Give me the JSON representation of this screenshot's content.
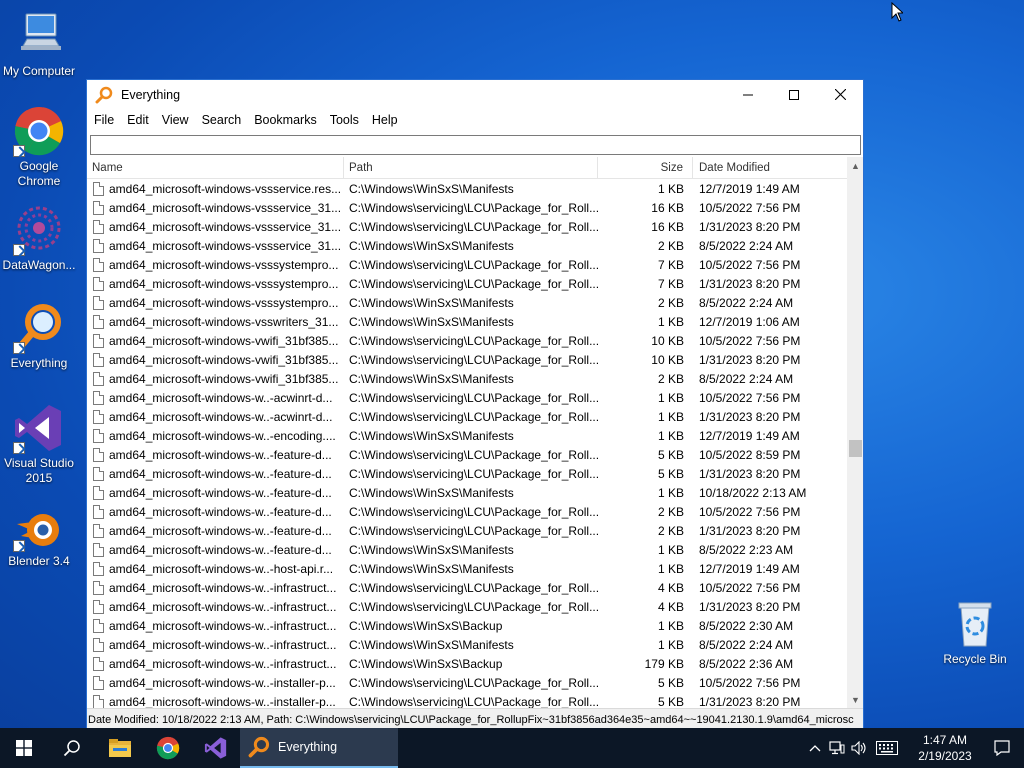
{
  "desktop": {
    "icons": [
      {
        "label": "My Computer"
      },
      {
        "label": "Google Chrome"
      },
      {
        "label": "DataWagon..."
      },
      {
        "label": "Everything"
      },
      {
        "label": "Visual Studio 2015"
      },
      {
        "label": "Blender 3.4"
      },
      {
        "label": "Recycle Bin"
      }
    ]
  },
  "window": {
    "title": "Everything",
    "menu": [
      "File",
      "Edit",
      "View",
      "Search",
      "Bookmarks",
      "Tools",
      "Help"
    ],
    "search": {
      "value": "",
      "placeholder": ""
    },
    "columns": {
      "name": "Name",
      "path": "Path",
      "size": "Size",
      "date": "Date Modified"
    },
    "rows": [
      {
        "name": "amd64_microsoft-windows-vssservice.res...",
        "path": "C:\\Windows\\WinSxS\\Manifests",
        "size": "1 KB",
        "date": "12/7/2019 1:49 AM"
      },
      {
        "name": "amd64_microsoft-windows-vssservice_31...",
        "path": "C:\\Windows\\servicing\\LCU\\Package_for_Roll...",
        "size": "16 KB",
        "date": "10/5/2022 7:56 PM"
      },
      {
        "name": "amd64_microsoft-windows-vssservice_31...",
        "path": "C:\\Windows\\servicing\\LCU\\Package_for_Roll...",
        "size": "16 KB",
        "date": "1/31/2023 8:20 PM"
      },
      {
        "name": "amd64_microsoft-windows-vssservice_31...",
        "path": "C:\\Windows\\WinSxS\\Manifests",
        "size": "2 KB",
        "date": "8/5/2022 2:24 AM"
      },
      {
        "name": "amd64_microsoft-windows-vsssystempro...",
        "path": "C:\\Windows\\servicing\\LCU\\Package_for_Roll...",
        "size": "7 KB",
        "date": "10/5/2022 7:56 PM"
      },
      {
        "name": "amd64_microsoft-windows-vsssystempro...",
        "path": "C:\\Windows\\servicing\\LCU\\Package_for_Roll...",
        "size": "7 KB",
        "date": "1/31/2023 8:20 PM"
      },
      {
        "name": "amd64_microsoft-windows-vsssystempro...",
        "path": "C:\\Windows\\WinSxS\\Manifests",
        "size": "2 KB",
        "date": "8/5/2022 2:24 AM"
      },
      {
        "name": "amd64_microsoft-windows-vsswriters_31...",
        "path": "C:\\Windows\\WinSxS\\Manifests",
        "size": "1 KB",
        "date": "12/7/2019 1:06 AM"
      },
      {
        "name": "amd64_microsoft-windows-vwifi_31bf385...",
        "path": "C:\\Windows\\servicing\\LCU\\Package_for_Roll...",
        "size": "10 KB",
        "date": "10/5/2022 7:56 PM"
      },
      {
        "name": "amd64_microsoft-windows-vwifi_31bf385...",
        "path": "C:\\Windows\\servicing\\LCU\\Package_for_Roll...",
        "size": "10 KB",
        "date": "1/31/2023 8:20 PM"
      },
      {
        "name": "amd64_microsoft-windows-vwifi_31bf385...",
        "path": "C:\\Windows\\WinSxS\\Manifests",
        "size": "2 KB",
        "date": "8/5/2022 2:24 AM"
      },
      {
        "name": "amd64_microsoft-windows-w..-acwinrt-d...",
        "path": "C:\\Windows\\servicing\\LCU\\Package_for_Roll...",
        "size": "1 KB",
        "date": "10/5/2022 7:56 PM"
      },
      {
        "name": "amd64_microsoft-windows-w..-acwinrt-d...",
        "path": "C:\\Windows\\servicing\\LCU\\Package_for_Roll...",
        "size": "1 KB",
        "date": "1/31/2023 8:20 PM"
      },
      {
        "name": "amd64_microsoft-windows-w..-encoding....",
        "path": "C:\\Windows\\WinSxS\\Manifests",
        "size": "1 KB",
        "date": "12/7/2019 1:49 AM"
      },
      {
        "name": "amd64_microsoft-windows-w..-feature-d...",
        "path": "C:\\Windows\\servicing\\LCU\\Package_for_Roll...",
        "size": "5 KB",
        "date": "10/5/2022 8:59 PM"
      },
      {
        "name": "amd64_microsoft-windows-w..-feature-d...",
        "path": "C:\\Windows\\servicing\\LCU\\Package_for_Roll...",
        "size": "5 KB",
        "date": "1/31/2023 8:20 PM"
      },
      {
        "name": "amd64_microsoft-windows-w..-feature-d...",
        "path": "C:\\Windows\\WinSxS\\Manifests",
        "size": "1 KB",
        "date": "10/18/2022 2:13 AM"
      },
      {
        "name": "amd64_microsoft-windows-w..-feature-d...",
        "path": "C:\\Windows\\servicing\\LCU\\Package_for_Roll...",
        "size": "2 KB",
        "date": "10/5/2022 7:56 PM"
      },
      {
        "name": "amd64_microsoft-windows-w..-feature-d...",
        "path": "C:\\Windows\\servicing\\LCU\\Package_for_Roll...",
        "size": "2 KB",
        "date": "1/31/2023 8:20 PM"
      },
      {
        "name": "amd64_microsoft-windows-w..-feature-d...",
        "path": "C:\\Windows\\WinSxS\\Manifests",
        "size": "1 KB",
        "date": "8/5/2022 2:23 AM"
      },
      {
        "name": "amd64_microsoft-windows-w..-host-api.r...",
        "path": "C:\\Windows\\WinSxS\\Manifests",
        "size": "1 KB",
        "date": "12/7/2019 1:49 AM"
      },
      {
        "name": "amd64_microsoft-windows-w..-infrastruct...",
        "path": "C:\\Windows\\servicing\\LCU\\Package_for_Roll...",
        "size": "4 KB",
        "date": "10/5/2022 7:56 PM"
      },
      {
        "name": "amd64_microsoft-windows-w..-infrastruct...",
        "path": "C:\\Windows\\servicing\\LCU\\Package_for_Roll...",
        "size": "4 KB",
        "date": "1/31/2023 8:20 PM"
      },
      {
        "name": "amd64_microsoft-windows-w..-infrastruct...",
        "path": "C:\\Windows\\WinSxS\\Backup",
        "size": "1 KB",
        "date": "8/5/2022 2:30 AM"
      },
      {
        "name": "amd64_microsoft-windows-w..-infrastruct...",
        "path": "C:\\Windows\\WinSxS\\Manifests",
        "size": "1 KB",
        "date": "8/5/2022 2:24 AM"
      },
      {
        "name": "amd64_microsoft-windows-w..-infrastruct...",
        "path": "C:\\Windows\\WinSxS\\Backup",
        "size": "179 KB",
        "date": "8/5/2022 2:36 AM"
      },
      {
        "name": "amd64_microsoft-windows-w..-installer-p...",
        "path": "C:\\Windows\\servicing\\LCU\\Package_for_Roll...",
        "size": "5 KB",
        "date": "10/5/2022 7:56 PM"
      },
      {
        "name": "amd64_microsoft-windows-w..-installer-p...",
        "path": "C:\\Windows\\servicing\\LCU\\Package_for_Roll...",
        "size": "5 KB",
        "date": "1/31/2023 8:20 PM"
      }
    ],
    "status": "Date Modified: 10/18/2022 2:13 AM, Path: C:\\Windows\\servicing\\LCU\\Package_for_RollupFix~31bf3856ad364e35~amd64~~19041.2130.1.9\\amd64_microsc"
  },
  "taskbar": {
    "active_app_label": "Everything",
    "time": "1:47 AM",
    "date": "2/19/2023"
  },
  "colors": {
    "desktop_blue": "#1565d2",
    "taskbar": "#0c1726",
    "everything_orange": "#f08a1c",
    "vs_purple": "#6a3fb5"
  },
  "icons": [
    "computer-icon",
    "chrome-icon",
    "datawagon-icon",
    "everything-icon",
    "visual-studio-icon",
    "blender-icon",
    "recycle-bin-icon",
    "file-icon",
    "windows-start-icon",
    "search-icon",
    "file-explorer-icon",
    "chevron-up-icon",
    "network-icon",
    "volume-icon",
    "keyboard-icon",
    "notification-icon"
  ]
}
